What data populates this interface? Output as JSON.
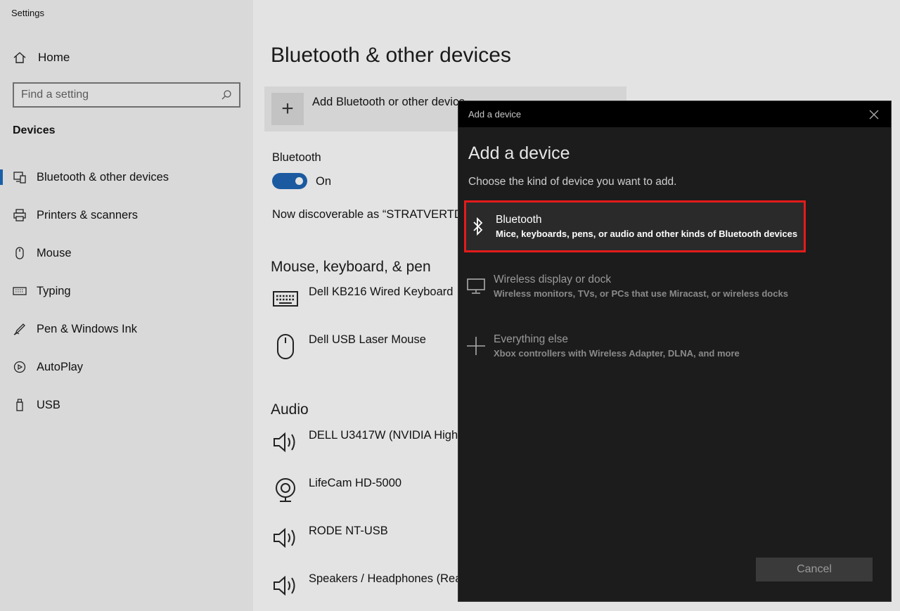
{
  "window": {
    "title": "Settings"
  },
  "sidebar": {
    "home_label": "Home",
    "search_placeholder": "Find a setting",
    "section_label": "Devices",
    "items": [
      {
        "label": "Bluetooth & other devices",
        "icon": "bluetooth-devices-icon",
        "active": true
      },
      {
        "label": "Printers & scanners",
        "icon": "printer-icon"
      },
      {
        "label": "Mouse",
        "icon": "mouse-icon"
      },
      {
        "label": "Typing",
        "icon": "keyboard-icon"
      },
      {
        "label": "Pen & Windows Ink",
        "icon": "pen-icon"
      },
      {
        "label": "AutoPlay",
        "icon": "autoplay-icon"
      },
      {
        "label": "USB",
        "icon": "usb-icon"
      }
    ]
  },
  "main": {
    "title": "Bluetooth & other devices",
    "add_button_label": "Add Bluetooth or other device",
    "bluetooth_label": "Bluetooth",
    "bluetooth_state": "On",
    "discoverable_text": "Now discoverable as “STRATVERTDE",
    "sections": {
      "mkp_title": "Mouse, keyboard, & pen",
      "mkp_devices": [
        "Dell KB216 Wired Keyboard",
        "Dell USB Laser Mouse"
      ],
      "audio_title": "Audio",
      "audio_devices": [
        "DELL U3417W (NVIDIA High",
        "LifeCam HD-5000",
        "RODE NT-USB",
        "Speakers / Headphones (Rea"
      ]
    }
  },
  "dialog": {
    "titlebar": "Add a device",
    "heading": "Add a device",
    "subtitle": "Choose the kind of device you want to add.",
    "options": [
      {
        "name": "Bluetooth",
        "description": "Mice, keyboards, pens, or audio and other kinds of Bluetooth devices",
        "icon": "bluetooth-icon",
        "selected": true
      },
      {
        "name": "Wireless display or dock",
        "description": "Wireless monitors, TVs, or PCs that use Miracast, or wireless docks",
        "icon": "monitor-icon"
      },
      {
        "name": "Everything else",
        "description": "Xbox controllers with Wireless Adapter, DLNA, and more",
        "icon": "plus-icon"
      }
    ],
    "cancel_label": "Cancel"
  },
  "colors": {
    "accent": "#1b5aa0",
    "highlight": "#e41b1b",
    "dialog_bg": "#1c1c1c"
  }
}
